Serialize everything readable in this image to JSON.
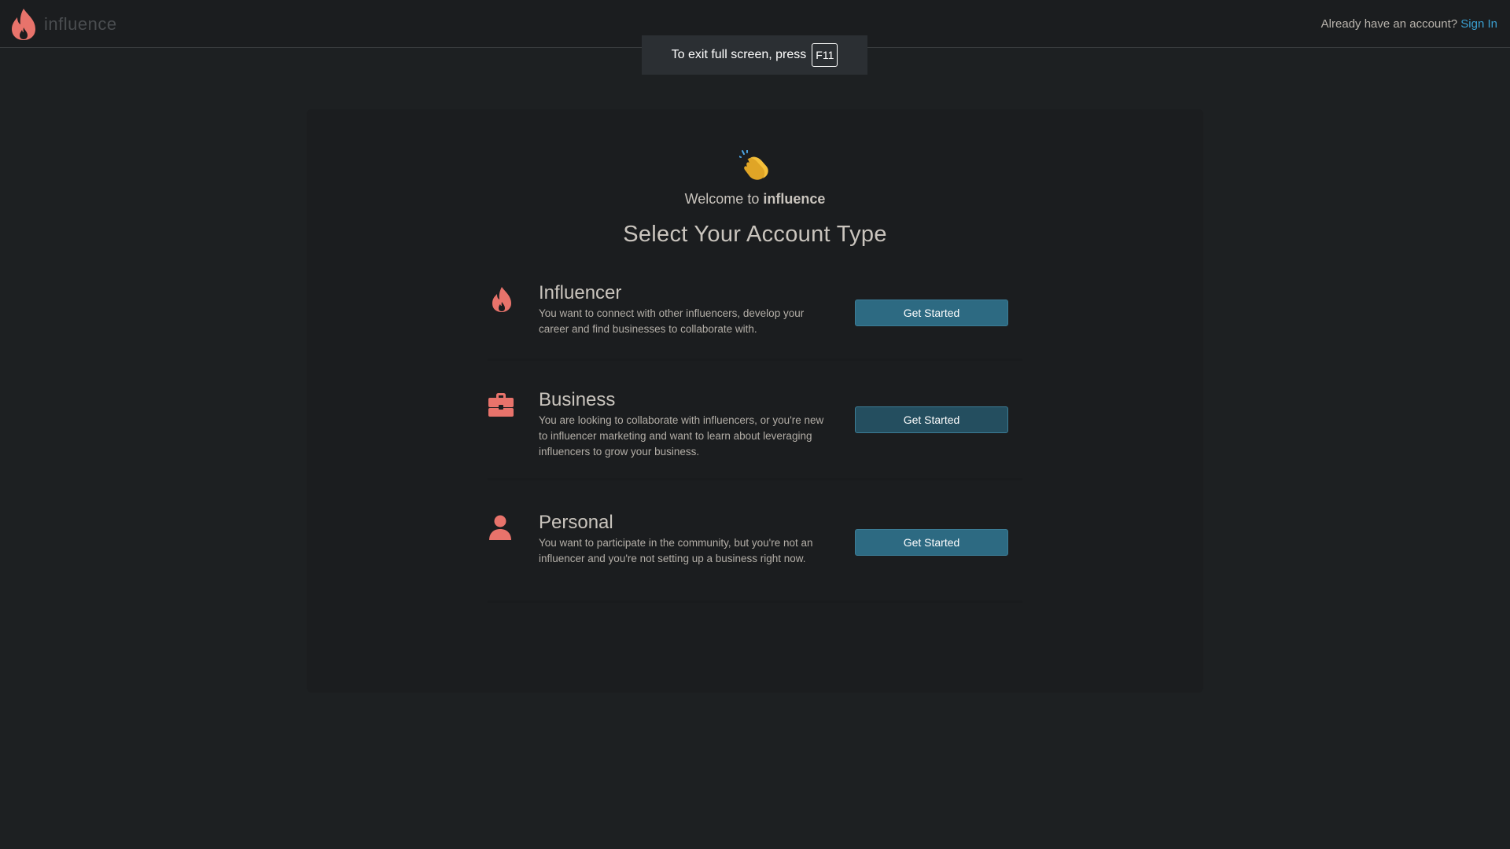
{
  "header": {
    "brand": "influence",
    "signin_prompt": "Already have an account?",
    "signin_label": "Sign In"
  },
  "fullscreen_notice": {
    "text": "To exit full screen, press",
    "key": "F11"
  },
  "main": {
    "welcome_prefix": "Welcome to",
    "welcome_brand": "influence",
    "title": "Select Your Account Type",
    "options": [
      {
        "icon": "flame-icon",
        "title": "Influencer",
        "description": "You want to connect with other influencers, develop your career and find businesses to collaborate with.",
        "button_label": "Get Started"
      },
      {
        "icon": "briefcase-icon",
        "title": "Business",
        "description": "You are looking to collaborate with influencers, or you're new to influencer marketing and want to learn about leveraging influencers to grow your business.",
        "button_label": "Get Started"
      },
      {
        "icon": "person-icon",
        "title": "Personal",
        "description": "You want to participate in the community, but you're not an influencer and you're not setting up a business right now.",
        "button_label": "Get Started"
      }
    ]
  },
  "colors": {
    "accent": "#e8736b",
    "link": "#3a9fd0",
    "button": "#2d6a82",
    "background": "#1d2022"
  }
}
